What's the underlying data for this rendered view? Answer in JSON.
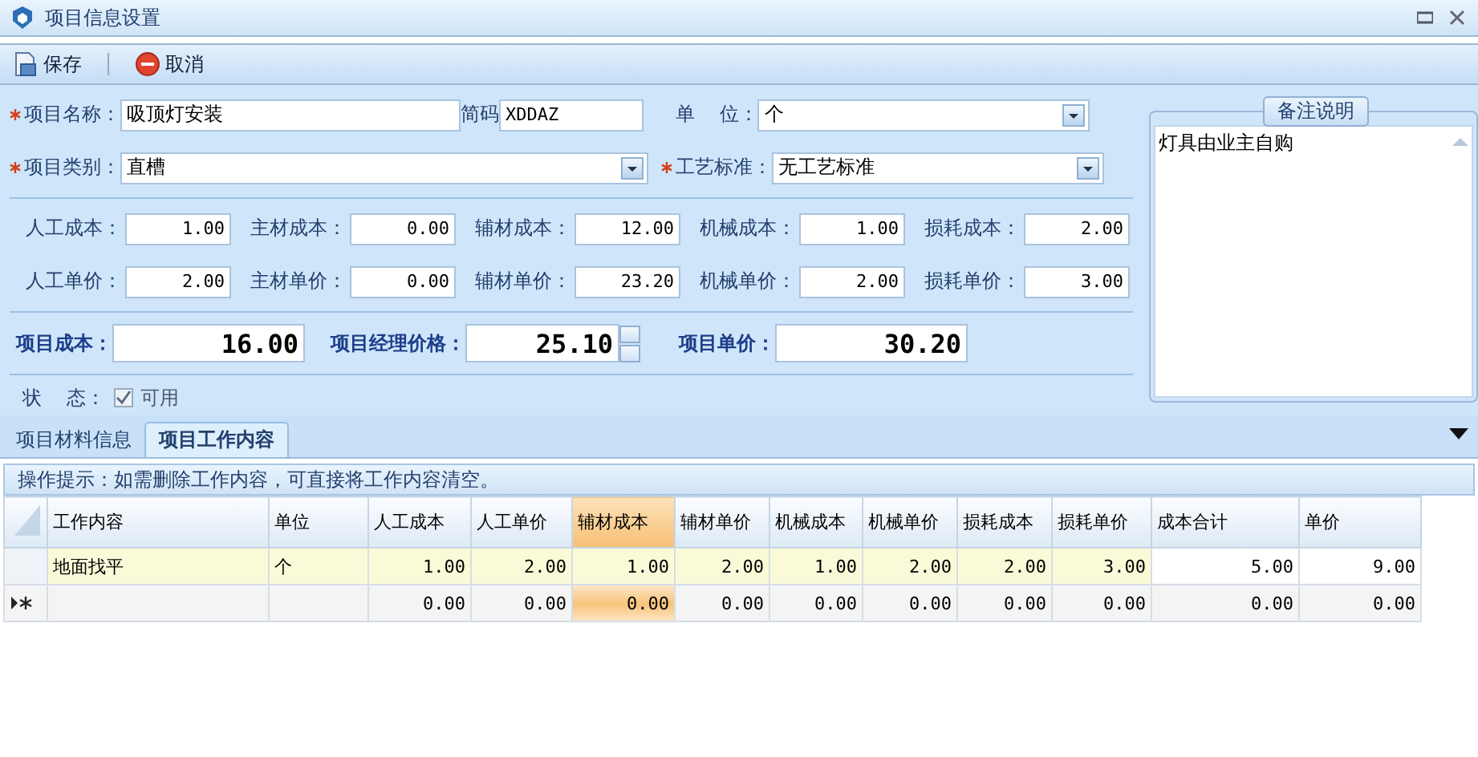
{
  "window": {
    "title": "项目信息设置"
  },
  "toolbar": [
    {
      "kind": "save",
      "label": "保存"
    },
    {
      "kind": "cancel",
      "label": "取消"
    }
  ],
  "form": {
    "name": {
      "label": "项目名称：",
      "required": true,
      "value": "吸顶灯安装"
    },
    "code": {
      "label": "简码",
      "value": "XDDAZ"
    },
    "unit": {
      "label": "单    位：",
      "required": false,
      "value": "个"
    },
    "category": {
      "label": "项目类别：",
      "required": true,
      "value": "直槽"
    },
    "standard": {
      "label": "工艺标准：",
      "required": true,
      "value": "无工艺标准"
    },
    "cost_fields": [
      {
        "label": "人工成本：",
        "value": "1.00"
      },
      {
        "label": "主材成本：",
        "value": "0.00"
      },
      {
        "label": "辅材成本：",
        "value": "12.00"
      },
      {
        "label": "机械成本：",
        "value": "1.00"
      },
      {
        "label": "损耗成本：",
        "value": "2.00"
      }
    ],
    "price_fields": [
      {
        "label": "人工单价：",
        "value": "2.00"
      },
      {
        "label": "主材单价：",
        "value": "0.00"
      },
      {
        "label": "辅材单价：",
        "value": "23.20"
      },
      {
        "label": "机械单价：",
        "value": "2.00"
      },
      {
        "label": "损耗单价：",
        "value": "3.00"
      }
    ],
    "totals": [
      {
        "kind": "plain",
        "label": "项目成本：",
        "value": "16.00"
      },
      {
        "kind": "spinner",
        "label": "项目经理价格：",
        "value": "25.10"
      },
      {
        "kind": "plain",
        "label": "项目单价：",
        "value": "30.20"
      }
    ],
    "status": {
      "label": "状    态：",
      "checkbox": {
        "label": "可用",
        "checked": true,
        "disabled": true
      }
    }
  },
  "memo": {
    "legend": "备注说明",
    "value": "灯具由业主自购"
  },
  "tabs": [
    {
      "label": "项目材料信息",
      "selected": false
    },
    {
      "label": "项目工作内容",
      "selected": true
    }
  ],
  "hint": "操作提示：如需删除工作内容，可直接将工作内容清空。",
  "grid": {
    "columns": [
      {
        "label": "工作内容",
        "selected": false,
        "editable": true
      },
      {
        "label": "单位",
        "selected": false,
        "editable": true
      },
      {
        "label": "人工成本",
        "selected": false,
        "editable": true
      },
      {
        "label": "人工单价",
        "selected": false,
        "editable": true
      },
      {
        "label": "辅材成本",
        "selected": true,
        "editable": true
      },
      {
        "label": "辅材单价",
        "selected": false,
        "editable": true
      },
      {
        "label": "机械成本",
        "selected": false,
        "editable": true
      },
      {
        "label": "机械单价",
        "selected": false,
        "editable": true
      },
      {
        "label": "损耗成本",
        "selected": false,
        "editable": true
      },
      {
        "label": "损耗单价",
        "selected": false,
        "editable": true
      },
      {
        "label": "成本合计",
        "selected": false,
        "editable": false
      },
      {
        "label": "单价",
        "selected": false,
        "editable": false
      }
    ],
    "rows": [
      {
        "kind": "data",
        "cells": [
          "地面找平",
          "个",
          "1.00",
          "2.00",
          "1.00",
          "2.00",
          "1.00",
          "2.00",
          "2.00",
          "3.00",
          "5.00",
          "9.00"
        ]
      },
      {
        "kind": "new",
        "cells": [
          null,
          null,
          "0.00",
          "0.00",
          "0.00",
          "0.00",
          "0.00",
          "0.00",
          "0.00",
          "0.00",
          "0.00",
          "0.00"
        ]
      }
    ]
  }
}
